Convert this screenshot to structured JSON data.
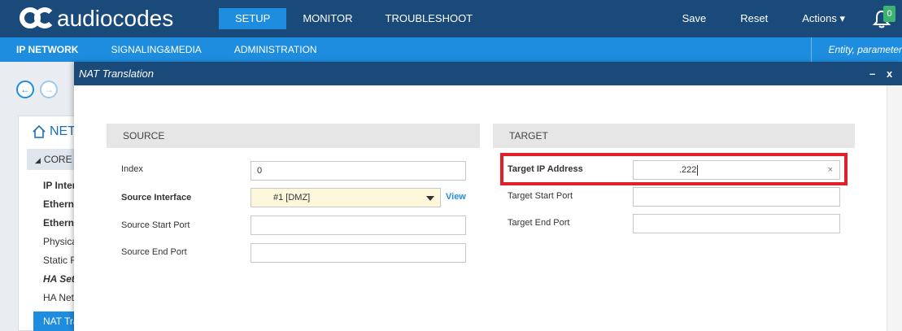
{
  "header": {
    "logo_text": "audiocodes",
    "nav": [
      "SETUP",
      "MONITOR",
      "TROUBLESHOOT"
    ],
    "active_nav": "SETUP",
    "save_label": "Save",
    "reset_label": "Reset",
    "actions_label": "Actions ▾",
    "notification_count": "0"
  },
  "subnav": {
    "items": [
      "IP NETWORK",
      "SIGNALING&MEDIA",
      "ADMINISTRATION"
    ],
    "search_placeholder": "Entity, parameter"
  },
  "tree": {
    "title": "NET",
    "core_label": "CORE E",
    "items": [
      "IP Inter",
      "Ethern",
      "Ethern",
      "Physica",
      "Static R",
      "HA Set",
      "HA Net"
    ],
    "selected_item": "NAT Tra"
  },
  "dialog": {
    "title": "NAT Translation",
    "minimize": "–",
    "close": "x",
    "source": {
      "heading": "SOURCE",
      "index_label": "Index",
      "index_value": "0",
      "interface_label": "Source Interface",
      "interface_value": "#1 [DMZ]",
      "view_link": "View",
      "start_port_label": "Source Start Port",
      "start_port_value": "",
      "end_port_label": "Source End Port",
      "end_port_value": ""
    },
    "target": {
      "heading": "TARGET",
      "ip_label": "Target IP Address",
      "ip_value": ".222",
      "clear_icon": "×",
      "start_port_label": "Target Start Port",
      "start_port_value": "",
      "end_port_label": "Target End Port",
      "end_port_value": ""
    }
  },
  "colors": {
    "header_bg": "#1a4a7a",
    "accent": "#1e8de0",
    "highlight_border": "#e0212b",
    "select_bg": "#fdf7dc",
    "badge": "#3cb371"
  }
}
